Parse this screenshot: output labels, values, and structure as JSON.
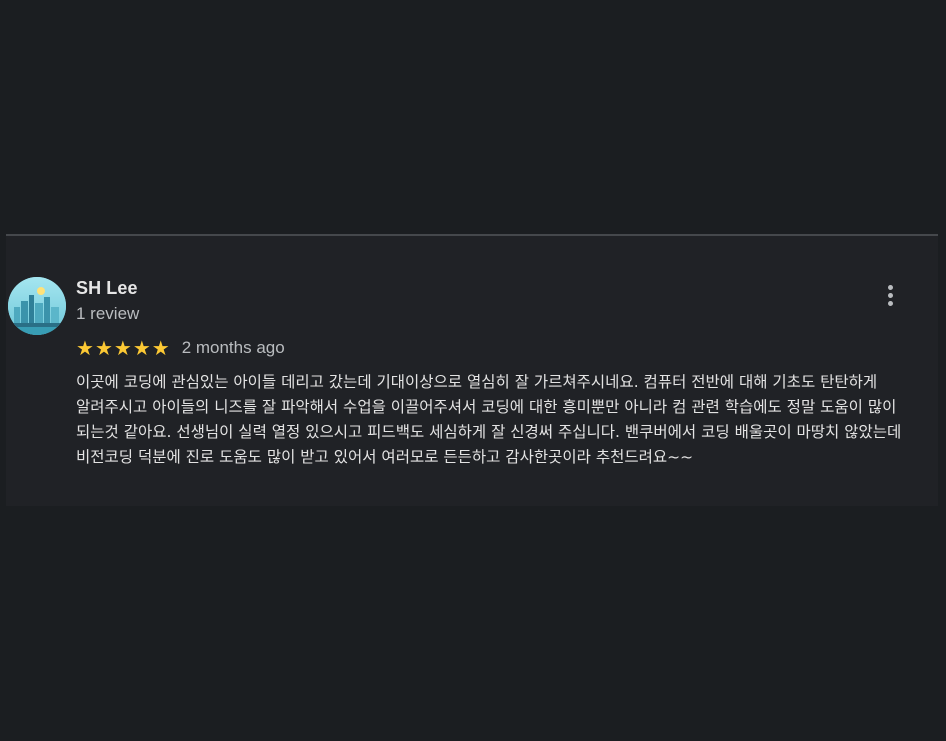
{
  "review": {
    "author_name": "SH Lee",
    "author_meta": "1 review",
    "rating": 5,
    "stars": [
      "★",
      "★",
      "★",
      "★",
      "★"
    ],
    "date": "2 months ago",
    "text": "이곳에 코딩에 관심있는 아이들 데리고 갔는데 기대이상으로 열심히 잘 가르쳐주시네요. 컴퓨터 전반에 대해 기초도 탄탄하게 알려주시고 아이들의 니즈를 잘 파악해서 수업을 이끌어주셔서 코딩에 대한 흥미뿐만 아니라 컴 관련 학습에도 정말 도움이 많이 되는것 같아요. 선생님이 실력 열정 있으시고 피드백도 세심하게 잘 신경써 주십니다. 밴쿠버에서 코딩 배울곳이 마땅치 않았는데 비전코딩 덕분에 진로 도움도 많이 받고 있어서 여러모로 든든하고 감사한곳이라 추천드려요~~",
    "star_color": "#fcc934",
    "more_icon": "more-vertical-icon",
    "avatar_icon": "city-skyline-avatar"
  }
}
